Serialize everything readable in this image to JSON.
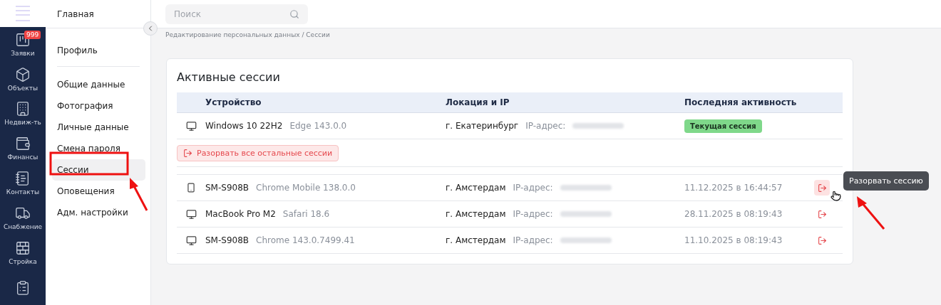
{
  "rail": {
    "items": [
      {
        "kind": "kanban",
        "label": "Заявки",
        "badge": "999"
      },
      {
        "kind": "box",
        "label": "Объекты"
      },
      {
        "kind": "building",
        "label": "Недвиж-ть"
      },
      {
        "kind": "wallet",
        "label": "Финансы"
      },
      {
        "kind": "notebook",
        "label": "Контакты"
      },
      {
        "kind": "truck",
        "label": "Снабжение"
      },
      {
        "kind": "brick",
        "label": "Стройка"
      },
      {
        "kind": "clipboard"
      }
    ]
  },
  "sidebar": {
    "title": "Главная",
    "profile": "Профиль",
    "items": [
      {
        "label": "Общие данные",
        "selected": false
      },
      {
        "label": "Фотография",
        "selected": false
      },
      {
        "label": "Личные данные",
        "selected": false
      },
      {
        "label": "Смена пароля",
        "selected": false
      },
      {
        "label": "Сессии",
        "selected": true
      },
      {
        "label": "Оповещения",
        "selected": false
      },
      {
        "label": "Адм. настройки",
        "selected": false
      }
    ]
  },
  "search": {
    "placeholder": "Поиск"
  },
  "breadcrumb": "Редактирование персональных данных / Сессии",
  "card": {
    "title": "Активные сессии",
    "columns": [
      "Устройство",
      "Локация и IP",
      "Последняя активность"
    ],
    "current": {
      "kind": "desktop",
      "device": "Windows 10 22H2",
      "browser": "Edge 143.0.0",
      "city": "г. Екатеринбург",
      "ip_label": "IP-адрес:",
      "badge": "Текущая сессия"
    },
    "terminate_all": "Разорвать все остальные сессии",
    "rows": [
      {
        "kind": "mobile",
        "device": "SM-S908B",
        "browser": "Chrome Mobile 138.0.0",
        "city": "г. Амстердам",
        "ip_label": "IP-адрес:",
        "activity": "11.12.2025 в 16:44:57",
        "hovered": true,
        "tooltip": "Разорвать сессию"
      },
      {
        "kind": "desktop",
        "device": "MacBook Pro M2",
        "browser": "Safari 18.6",
        "city": "г. Амстердам",
        "ip_label": "IP-адрес:",
        "activity": "28.11.2025 в 08:19:43",
        "hovered": false
      },
      {
        "kind": "desktop",
        "device": "SM-S908B",
        "browser": "Chrome 143.0.7499.41",
        "city": "г. Амстердам",
        "ip_label": "IP-адрес:",
        "activity": "11.10.2025 в 08:19:43",
        "hovered": false
      }
    ]
  }
}
